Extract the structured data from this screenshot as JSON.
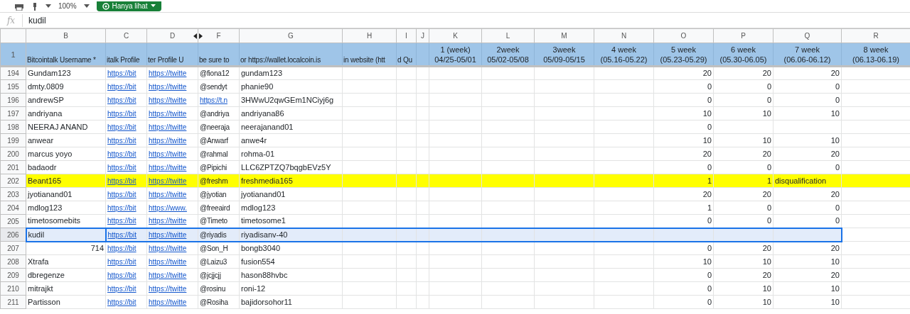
{
  "toolbar": {
    "zoom": "100%",
    "mode_button": "Hanya lihat"
  },
  "formula_bar": {
    "label": "fx",
    "value": "kudil"
  },
  "columns": [
    {
      "letter": "B",
      "hidden_before": false
    },
    {
      "letter": "C",
      "hidden_before": false
    },
    {
      "letter": "D",
      "hidden_before": false
    },
    {
      "letter": "F",
      "hidden_before": true
    },
    {
      "letter": "G",
      "hidden_before": false
    },
    {
      "letter": "H",
      "hidden_before": false
    },
    {
      "letter": "I",
      "hidden_before": false
    },
    {
      "letter": "J",
      "hidden_before": false
    },
    {
      "letter": "K",
      "hidden_before": false
    },
    {
      "letter": "L",
      "hidden_before": false
    },
    {
      "letter": "M",
      "hidden_before": false
    },
    {
      "letter": "N",
      "hidden_before": false
    },
    {
      "letter": "O",
      "hidden_before": false
    },
    {
      "letter": "P",
      "hidden_before": false
    },
    {
      "letter": "Q",
      "hidden_before": false
    },
    {
      "letter": "R",
      "hidden_before": false
    }
  ],
  "header_row": {
    "number": "1",
    "cells": {
      "B": [
        "Bitcointalk Username *"
      ],
      "C": [
        "italk Profile"
      ],
      "D": [
        "ter Profile U"
      ],
      "F": [
        "be sure to"
      ],
      "G": [
        "or https://wallet.localcoin.is"
      ],
      "H": [
        "in website (htt"
      ],
      "I": [
        "d Qu"
      ],
      "K": [
        "1 (week)",
        "04/25-05/01"
      ],
      "L": [
        "2week",
        "05/02-05/08"
      ],
      "M": [
        "3week",
        "05/09-05/15"
      ],
      "N": [
        "4 week",
        "(05.16-05.22)"
      ],
      "O": [
        "5 week",
        "(05.23-05.29)"
      ],
      "P": [
        "6 week",
        "(05.30-06.05)"
      ],
      "Q": [
        "7 week",
        "(06.06-06.12)"
      ],
      "R": [
        "8 week",
        "(06.13-06.19)"
      ]
    }
  },
  "rows": [
    {
      "number": "194",
      "highlighted": false,
      "selected": false,
      "cells": {
        "B": {
          "text": "Gundam123",
          "kind": "text"
        },
        "C": {
          "text": "https://bit",
          "kind": "link"
        },
        "D": {
          "text": "https://twitte",
          "kind": "link"
        },
        "F": {
          "text": "@fiona12",
          "kind": "text"
        },
        "G": {
          "text": "gundam123",
          "kind": "text"
        },
        "O": {
          "text": "20",
          "kind": "number"
        },
        "P": {
          "text": "20",
          "kind": "number"
        },
        "Q": {
          "text": "20",
          "kind": "number"
        }
      }
    },
    {
      "number": "195",
      "highlighted": false,
      "selected": false,
      "cells": {
        "B": {
          "text": "dmty.0809",
          "kind": "text"
        },
        "C": {
          "text": "https://bit",
          "kind": "link"
        },
        "D": {
          "text": "https://twitte",
          "kind": "link"
        },
        "F": {
          "text": "@sendyt",
          "kind": "text"
        },
        "G": {
          "text": "phanie90",
          "kind": "text"
        },
        "O": {
          "text": "0",
          "kind": "number"
        },
        "P": {
          "text": "0",
          "kind": "number"
        },
        "Q": {
          "text": "0",
          "kind": "number"
        }
      }
    },
    {
      "number": "196",
      "highlighted": false,
      "selected": false,
      "cells": {
        "B": {
          "text": "andrewSP",
          "kind": "text"
        },
        "C": {
          "text": "https://bit",
          "kind": "link"
        },
        "D": {
          "text": "https://twitte",
          "kind": "link"
        },
        "F": {
          "text": "https://t.n",
          "kind": "link"
        },
        "G": {
          "text": "3HWwU2qwGEm1NCiyj6g",
          "kind": "text"
        },
        "O": {
          "text": "0",
          "kind": "number"
        },
        "P": {
          "text": "0",
          "kind": "number"
        },
        "Q": {
          "text": "0",
          "kind": "number"
        }
      }
    },
    {
      "number": "197",
      "highlighted": false,
      "selected": false,
      "cells": {
        "B": {
          "text": "andriyana",
          "kind": "text"
        },
        "C": {
          "text": "https://bit",
          "kind": "link"
        },
        "D": {
          "text": "https://twitte",
          "kind": "link"
        },
        "F": {
          "text": "@andriya",
          "kind": "text"
        },
        "G": {
          "text": "andriyana86",
          "kind": "text"
        },
        "O": {
          "text": "10",
          "kind": "number"
        },
        "P": {
          "text": "10",
          "kind": "number"
        },
        "Q": {
          "text": "10",
          "kind": "number"
        }
      }
    },
    {
      "number": "198",
      "highlighted": false,
      "selected": false,
      "cells": {
        "B": {
          "text": "NEERAJ ANAND",
          "kind": "text"
        },
        "C": {
          "text": "https://bit",
          "kind": "link"
        },
        "D": {
          "text": "https://twitte",
          "kind": "link"
        },
        "F": {
          "text": "@neeraja",
          "kind": "text"
        },
        "G": {
          "text": "neerajanand01",
          "kind": "text"
        },
        "O": {
          "text": "0",
          "kind": "number"
        }
      }
    },
    {
      "number": "199",
      "highlighted": false,
      "selected": false,
      "cells": {
        "B": {
          "text": "anwear",
          "kind": "text"
        },
        "C": {
          "text": "https://bit",
          "kind": "link"
        },
        "D": {
          "text": "https://twitte",
          "kind": "link"
        },
        "F": {
          "text": "@Anwarf",
          "kind": "text"
        },
        "G": {
          "text": "anwe4r",
          "kind": "text"
        },
        "O": {
          "text": "10",
          "kind": "number"
        },
        "P": {
          "text": "10",
          "kind": "number"
        },
        "Q": {
          "text": "10",
          "kind": "number"
        }
      }
    },
    {
      "number": "200",
      "highlighted": false,
      "selected": false,
      "cells": {
        "B": {
          "text": "marcus yoyo",
          "kind": "text"
        },
        "C": {
          "text": "https://bit",
          "kind": "link"
        },
        "D": {
          "text": "https://twitte",
          "kind": "link"
        },
        "F": {
          "text": "@rahmal",
          "kind": "text"
        },
        "G": {
          "text": "rohma-01",
          "kind": "text"
        },
        "O": {
          "text": "20",
          "kind": "number"
        },
        "P": {
          "text": "20",
          "kind": "number"
        },
        "Q": {
          "text": "20",
          "kind": "number"
        }
      }
    },
    {
      "number": "201",
      "highlighted": false,
      "selected": false,
      "cells": {
        "B": {
          "text": "badaodr",
          "kind": "text"
        },
        "C": {
          "text": "https://bit",
          "kind": "link"
        },
        "D": {
          "text": "https://twitte",
          "kind": "link"
        },
        "F": {
          "text": "@Pipichi",
          "kind": "text"
        },
        "G": {
          "text": "LLC6ZPTZQ7bqgbEVz5Y",
          "kind": "text"
        },
        "O": {
          "text": "0",
          "kind": "number"
        },
        "P": {
          "text": "0",
          "kind": "number"
        },
        "Q": {
          "text": "0",
          "kind": "number"
        }
      }
    },
    {
      "number": "202",
      "highlighted": true,
      "selected": false,
      "cells": {
        "B": {
          "text": "Beant165",
          "kind": "text"
        },
        "C": {
          "text": "https://bit",
          "kind": "link"
        },
        "D": {
          "text": "https://twitte",
          "kind": "link"
        },
        "F": {
          "text": "@freshm",
          "kind": "text"
        },
        "G": {
          "text": "freshmedia165",
          "kind": "text"
        },
        "O": {
          "text": "1",
          "kind": "number"
        },
        "P": {
          "text": "1",
          "kind": "number"
        },
        "Q": {
          "text": "disqualification",
          "kind": "text"
        }
      }
    },
    {
      "number": "203",
      "highlighted": false,
      "selected": false,
      "cells": {
        "B": {
          "text": "jyotianand01",
          "kind": "text"
        },
        "C": {
          "text": "https://bit",
          "kind": "link"
        },
        "D": {
          "text": "https://twitte",
          "kind": "link"
        },
        "F": {
          "text": "@jyotian",
          "kind": "text"
        },
        "G": {
          "text": "jyotianand01",
          "kind": "text"
        },
        "O": {
          "text": "20",
          "kind": "number"
        },
        "P": {
          "text": "20",
          "kind": "number"
        },
        "Q": {
          "text": "20",
          "kind": "number"
        }
      }
    },
    {
      "number": "204",
      "highlighted": false,
      "selected": false,
      "cells": {
        "B": {
          "text": "mdlog123",
          "kind": "text"
        },
        "C": {
          "text": "https://bit",
          "kind": "link"
        },
        "D": {
          "text": "https://www.",
          "kind": "link"
        },
        "F": {
          "text": "@freeaird",
          "kind": "text"
        },
        "G": {
          "text": "mdlog123",
          "kind": "text"
        },
        "O": {
          "text": "1",
          "kind": "number"
        },
        "P": {
          "text": "0",
          "kind": "number"
        },
        "Q": {
          "text": "0",
          "kind": "number"
        }
      }
    },
    {
      "number": "205",
      "highlighted": false,
      "selected": false,
      "cells": {
        "B": {
          "text": "timetosomebits",
          "kind": "text"
        },
        "C": {
          "text": "https://bit",
          "kind": "link"
        },
        "D": {
          "text": "https://twitte",
          "kind": "link"
        },
        "F": {
          "text": "@Timeto",
          "kind": "text"
        },
        "G": {
          "text": "timetosome1",
          "kind": "text"
        },
        "O": {
          "text": "0",
          "kind": "number"
        },
        "P": {
          "text": "0",
          "kind": "number"
        },
        "Q": {
          "text": "0",
          "kind": "number"
        }
      }
    },
    {
      "number": "206",
      "highlighted": false,
      "selected": true,
      "cells": {
        "B": {
          "text": "kudil",
          "kind": "text"
        },
        "C": {
          "text": "https://bit",
          "kind": "link"
        },
        "D": {
          "text": "https://twitte",
          "kind": "link"
        },
        "F": {
          "text": "@riyadis",
          "kind": "text"
        },
        "G": {
          "text": "riyadisanv-40",
          "kind": "text"
        }
      }
    },
    {
      "number": "207",
      "highlighted": false,
      "selected": false,
      "cells": {
        "B": {
          "text": "714",
          "kind": "number"
        },
        "C": {
          "text": "https://bit",
          "kind": "link"
        },
        "D": {
          "text": "https://twitte",
          "kind": "link"
        },
        "F": {
          "text": "@Son_H",
          "kind": "text"
        },
        "G": {
          "text": "bongb3040",
          "kind": "text"
        },
        "O": {
          "text": "0",
          "kind": "number"
        },
        "P": {
          "text": "20",
          "kind": "number"
        },
        "Q": {
          "text": "20",
          "kind": "number"
        }
      }
    },
    {
      "number": "208",
      "highlighted": false,
      "selected": false,
      "cells": {
        "B": {
          "text": "Xtrafa",
          "kind": "text"
        },
        "C": {
          "text": "https://bit",
          "kind": "link"
        },
        "D": {
          "text": "https://twitte",
          "kind": "link"
        },
        "F": {
          "text": "@Laizu3",
          "kind": "text"
        },
        "G": {
          "text": "fusion554",
          "kind": "text"
        },
        "O": {
          "text": "10",
          "kind": "number"
        },
        "P": {
          "text": "10",
          "kind": "number"
        },
        "Q": {
          "text": "10",
          "kind": "number"
        }
      }
    },
    {
      "number": "209",
      "highlighted": false,
      "selected": false,
      "cells": {
        "B": {
          "text": "dbregenze",
          "kind": "text"
        },
        "C": {
          "text": "https://bit",
          "kind": "link"
        },
        "D": {
          "text": "https://twitte",
          "kind": "link"
        },
        "F": {
          "text": "@jcjjcjj",
          "kind": "text"
        },
        "G": {
          "text": "hason88hvbc",
          "kind": "text"
        },
        "O": {
          "text": "0",
          "kind": "number"
        },
        "P": {
          "text": "20",
          "kind": "number"
        },
        "Q": {
          "text": "20",
          "kind": "number"
        }
      }
    },
    {
      "number": "210",
      "highlighted": false,
      "selected": false,
      "cells": {
        "B": {
          "text": "mitrajkt",
          "kind": "text"
        },
        "C": {
          "text": "https://bit",
          "kind": "link"
        },
        "D": {
          "text": "https://twitte",
          "kind": "link"
        },
        "F": {
          "text": "@rosinu",
          "kind": "text"
        },
        "G": {
          "text": "roni-12",
          "kind": "text"
        },
        "O": {
          "text": "0",
          "kind": "number"
        },
        "P": {
          "text": "10",
          "kind": "number"
        },
        "Q": {
          "text": "10",
          "kind": "number"
        }
      }
    },
    {
      "number": "211",
      "highlighted": false,
      "selected": false,
      "cells": {
        "B": {
          "text": "Partisson",
          "kind": "text"
        },
        "C": {
          "text": "https://bit",
          "kind": "link"
        },
        "D": {
          "text": "https://twitte",
          "kind": "link"
        },
        "F": {
          "text": "@Rosiha",
          "kind": "text"
        },
        "G": {
          "text": "bajidorsohor11",
          "kind": "text"
        },
        "O": {
          "text": "0",
          "kind": "number"
        },
        "P": {
          "text": "10",
          "kind": "number"
        },
        "Q": {
          "text": "10",
          "kind": "number"
        }
      }
    }
  ]
}
